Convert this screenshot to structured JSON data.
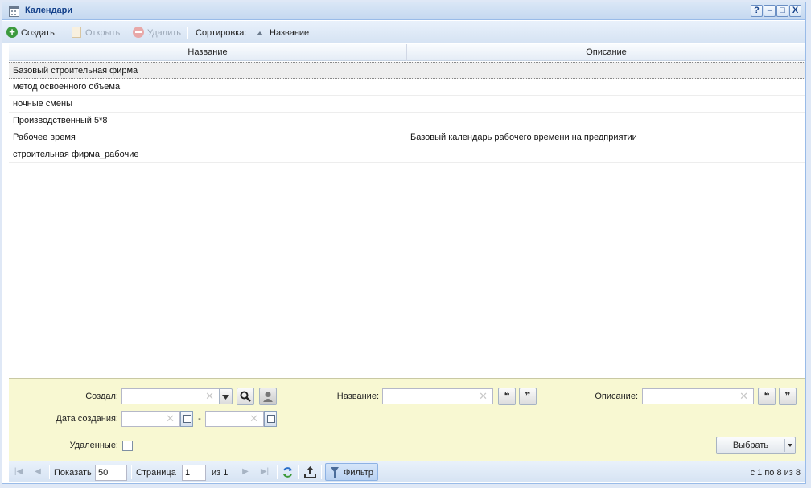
{
  "window": {
    "title": "Календари",
    "controls": {
      "help": "?",
      "minimize": "–",
      "maximize": "□",
      "close": "X"
    }
  },
  "toolbar": {
    "create": "Создать",
    "open": "Открыть",
    "delete": "Удалить",
    "sort_label": "Сортировка:",
    "sort_field": "Название"
  },
  "grid": {
    "columns": [
      "Название",
      "Описание"
    ],
    "rows": [
      {
        "name": "Базовый строительная фирма",
        "description": ""
      },
      {
        "name": "метод освоенного объема",
        "description": ""
      },
      {
        "name": "ночные смены",
        "description": ""
      },
      {
        "name": "Производственный 5*8",
        "description": ""
      },
      {
        "name": "Рабочее время",
        "description": "Базовый календарь рабочего времени на предприятии"
      },
      {
        "name": "строительная фирма_рабочие",
        "description": ""
      }
    ]
  },
  "filter": {
    "created_by_label": "Создал:",
    "name_label": "Название:",
    "description_label": "Описание:",
    "created_date_label": "Дата создания:",
    "date_dash": "-",
    "deleted_label": "Удаленные:",
    "quote_open": "❝",
    "quote_close": "❞",
    "clear_glyph": "✕",
    "select_button": "Выбрать"
  },
  "paging": {
    "show_label": "Показать",
    "page_size": "50",
    "page_label": "Страница",
    "page_number": "1",
    "of_pages": "из 1",
    "filter_button": "Фильтр",
    "summary": "с 1 по 8 из 8"
  }
}
